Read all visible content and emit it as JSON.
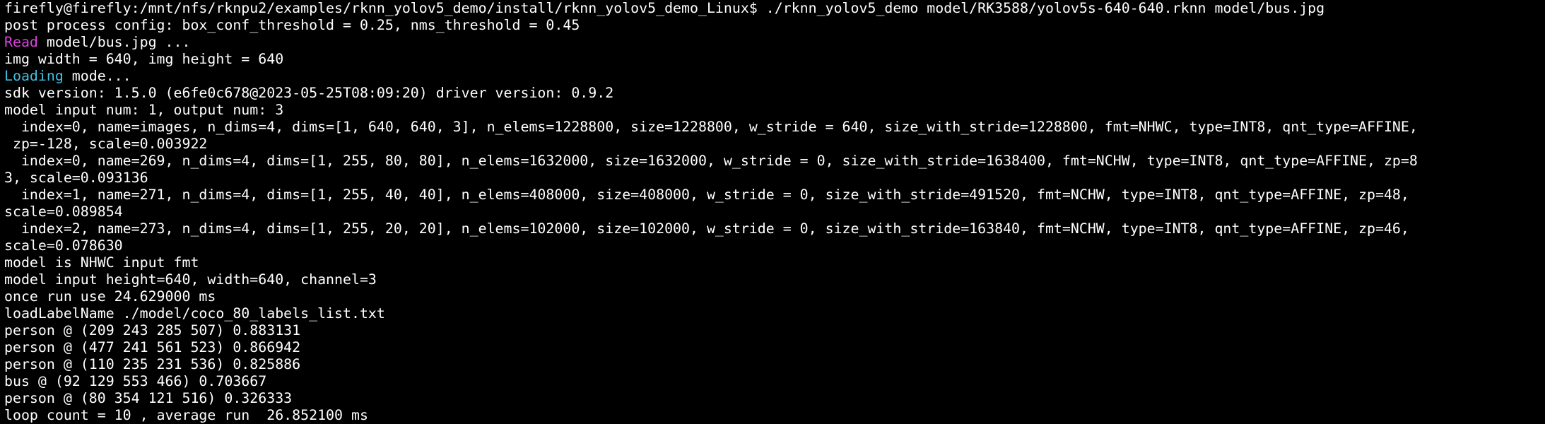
{
  "colors": {
    "background": "#000000",
    "text": "#ffffff",
    "read_keyword": "#e040e0",
    "loading_keyword": "#40c0e0"
  },
  "terminal": {
    "lines": [
      {
        "text": "firefly@firefly:/mnt/nfs/rknpu2/examples/rknn_yolov5_demo/install/rknn_yolov5_demo_Linux$ ./rknn_yolov5_demo model/RK3588/yolov5s-640-640.rknn model/bus.jpg"
      },
      {
        "text": "post process config: box_conf_threshold = 0.25, nms_threshold = 0.45"
      },
      {
        "kw": "Read",
        "kw_color": "read_keyword",
        "text": " model/bus.jpg ..."
      },
      {
        "text": "img width = 640, img height = 640"
      },
      {
        "kw": "Loading",
        "kw_color": "loading_keyword",
        "text": " mode..."
      },
      {
        "text": "sdk version: 1.5.0 (e6fe0c678@2023-05-25T08:09:20) driver version: 0.9.2"
      },
      {
        "text": "model input num: 1, output num: 3"
      },
      {
        "text": "  index=0, name=images, n_dims=4, dims=[1, 640, 640, 3], n_elems=1228800, size=1228800, w_stride = 640, size_with_stride=1228800, fmt=NHWC, type=INT8, qnt_type=AFFINE,"
      },
      {
        "text": " zp=-128, scale=0.003922"
      },
      {
        "text": "  index=0, name=269, n_dims=4, dims=[1, 255, 80, 80], n_elems=1632000, size=1632000, w_stride = 0, size_with_stride=1638400, fmt=NCHW, type=INT8, qnt_type=AFFINE, zp=8"
      },
      {
        "text": "3, scale=0.093136"
      },
      {
        "text": "  index=1, name=271, n_dims=4, dims=[1, 255, 40, 40], n_elems=408000, size=408000, w_stride = 0, size_with_stride=491520, fmt=NCHW, type=INT8, qnt_type=AFFINE, zp=48,"
      },
      {
        "text": "scale=0.089854"
      },
      {
        "text": "  index=2, name=273, n_dims=4, dims=[1, 255, 20, 20], n_elems=102000, size=102000, w_stride = 0, size_with_stride=163840, fmt=NCHW, type=INT8, qnt_type=AFFINE, zp=46,"
      },
      {
        "text": "scale=0.078630"
      },
      {
        "text": "model is NHWC input fmt"
      },
      {
        "text": "model input height=640, width=640, channel=3"
      },
      {
        "text": "once run use 24.629000 ms"
      },
      {
        "text": "loadLabelName ./model/coco_80_labels_list.txt"
      },
      {
        "text": "person @ (209 243 285 507) 0.883131"
      },
      {
        "text": "person @ (477 241 561 523) 0.866942"
      },
      {
        "text": "person @ (110 235 231 536) 0.825886"
      },
      {
        "text": "bus @ (92 129 553 466) 0.703667"
      },
      {
        "text": "person @ (80 354 121 516) 0.326333"
      },
      {
        "text": "loop count = 10 , average run  26.852100 ms"
      }
    ]
  }
}
